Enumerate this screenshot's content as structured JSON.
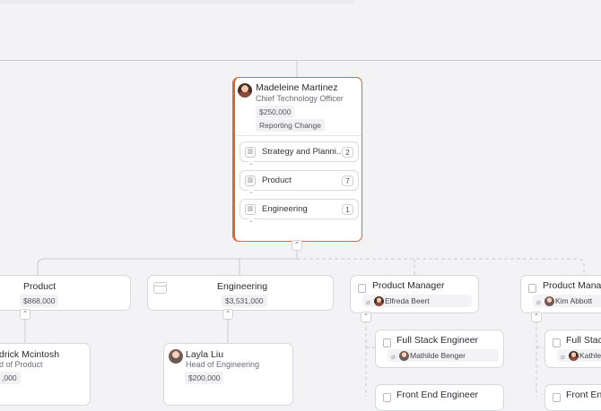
{
  "root": {
    "name": "Madeleine Martinez",
    "title": "Chief Technology Officer",
    "salary": "$250,000",
    "badge": "Reporting Change",
    "teams": [
      {
        "label": "Strategy and Planni...",
        "count": "2"
      },
      {
        "label": "Product",
        "count": "7"
      },
      {
        "label": "Engineering",
        "count": "1"
      }
    ],
    "accent": "#e0662f"
  },
  "departments": {
    "product": {
      "name": "Product",
      "budget": "$868,000"
    },
    "engineering": {
      "name": "Engineering",
      "budget": "$3,531,000"
    }
  },
  "people": {
    "product_head": {
      "name": "drick Mcintosh",
      "title": "d of Product",
      "salary": ",000"
    },
    "engineering_head": {
      "name": "Layla Liu",
      "title": "Head of Engineering",
      "salary": "$200,000"
    }
  },
  "roles": {
    "pm1": {
      "title": "Product Manager",
      "person": "Elfreda Beert"
    },
    "pm2": {
      "title": "Product Manag",
      "person": "Kim Abbott"
    },
    "fse1": {
      "title": "Full Stack Engineer",
      "person": "Mathilde Benger"
    },
    "fse2": {
      "title": "Full Stac",
      "person": "Kathle"
    },
    "fee1": {
      "title": "Front End Engineer"
    },
    "fee2": {
      "title": "Front En"
    }
  },
  "icons": {
    "chevron_up": "⌃",
    "chevron_down": "⌄",
    "paperclip": "⌀"
  }
}
